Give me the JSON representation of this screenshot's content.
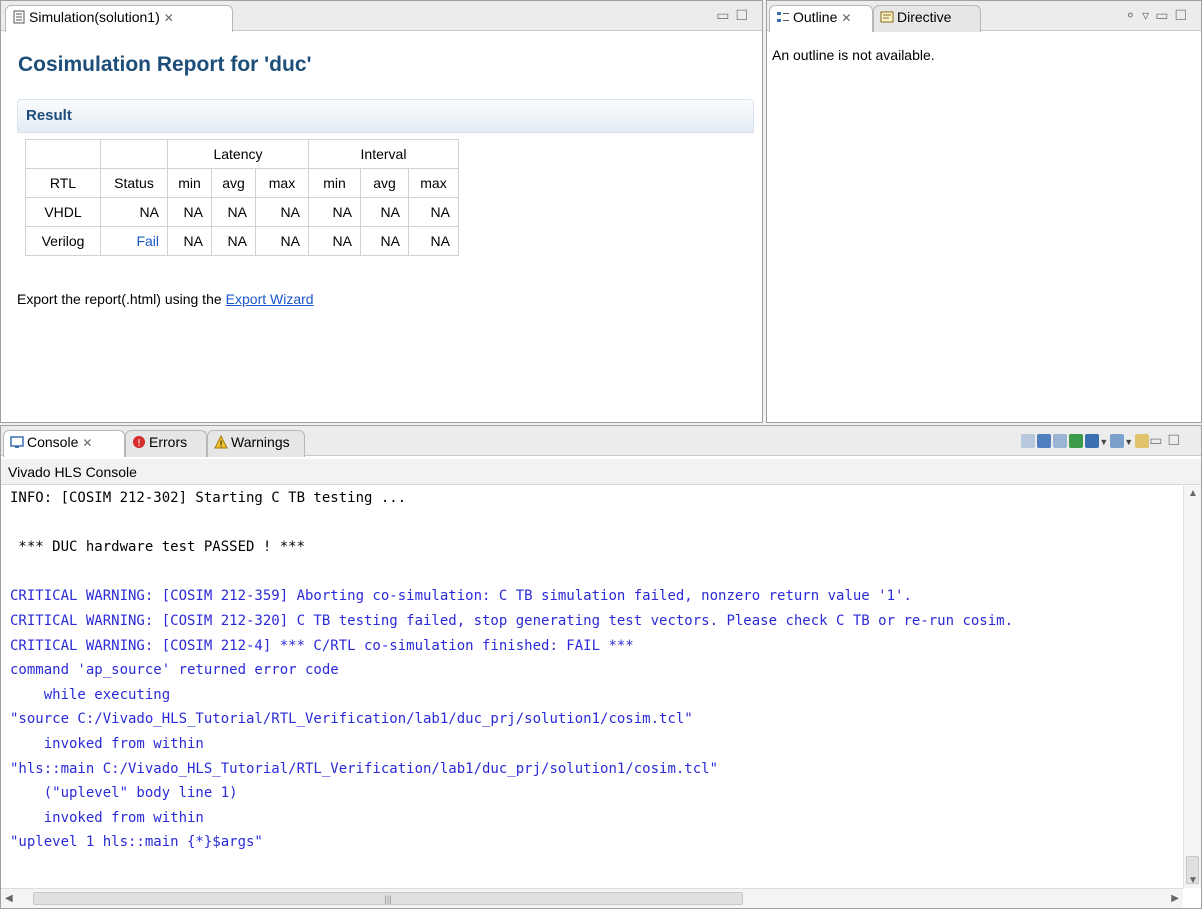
{
  "simulation": {
    "tab_label": "Simulation(solution1)",
    "tab_close": "✕",
    "title": "Cosimulation Report for 'duc'",
    "result_header": "Result",
    "table": {
      "group_headers": {
        "latency": "Latency",
        "interval": "Interval"
      },
      "columns": [
        "RTL",
        "Status",
        "min",
        "avg",
        "max",
        "min",
        "avg",
        "max"
      ],
      "rows": [
        [
          "VHDL",
          "NA",
          "NA",
          "NA",
          "NA",
          "NA",
          "NA",
          "NA"
        ],
        [
          "Verilog",
          "Fail",
          "NA",
          "NA",
          "NA",
          "NA",
          "NA",
          "NA"
        ]
      ]
    },
    "export_text": "Export the report(.html) using the",
    "export_link": "Export Wizard"
  },
  "outline": {
    "tab_outline": "Outline",
    "tab_directive": "Directive",
    "message": "An outline is not available."
  },
  "console": {
    "tab_console": "Console",
    "tab_errors": "Errors",
    "tab_warnings": "Warnings",
    "title": "Vivado HLS Console",
    "lines": [
      "INFO: [COSIM 212-302] Starting C TB testing ...",
      "",
      " *** DUC hardware test PASSED ! ***",
      "",
      "CRITICAL WARNING: [COSIM 212-359] Aborting co-simulation: C TB simulation failed, nonzero return value '1'.",
      "CRITICAL WARNING: [COSIM 212-320] C TB testing failed, stop generating test vectors. Please check C TB or re-run cosim.",
      "CRITICAL WARNING: [COSIM 212-4] *** C/RTL co-simulation finished: FAIL ***",
      "command 'ap_source' returned error code",
      "    while executing",
      "\"source C:/Vivado_HLS_Tutorial/RTL_Verification/lab1/duc_prj/solution1/cosim.tcl\"",
      "    invoked from within",
      "\"hls::main C:/Vivado_HLS_Tutorial/RTL_Verification/lab1/duc_prj/solution1/cosim.tcl\"",
      "    (\"uplevel\" body line 1)",
      "    invoked from within",
      "\"uplevel 1 hls::main {*}$args\""
    ],
    "blue_from_line": 4
  },
  "colors": {
    "title_blue": "#1d4e7a",
    "link_blue": "#1a56c8",
    "warning_blue": "#2a2ad8"
  }
}
